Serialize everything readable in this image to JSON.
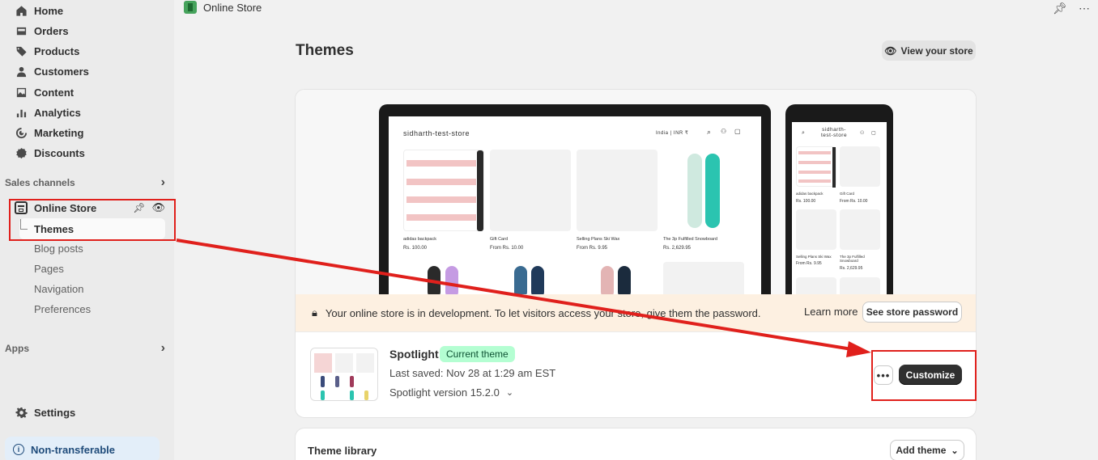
{
  "sidebar": {
    "nav": [
      {
        "label": "Home",
        "icon": "home-icon"
      },
      {
        "label": "Orders",
        "icon": "orders-icon"
      },
      {
        "label": "Products",
        "icon": "tag-icon"
      },
      {
        "label": "Customers",
        "icon": "person-icon"
      },
      {
        "label": "Content",
        "icon": "image-icon"
      },
      {
        "label": "Analytics",
        "icon": "bar-chart-icon"
      },
      {
        "label": "Marketing",
        "icon": "target-icon"
      },
      {
        "label": "Discounts",
        "icon": "discount-icon"
      }
    ],
    "sales_channels_label": "Sales channels",
    "online_store_label": "Online Store",
    "sub_items": [
      "Themes",
      "Blog posts",
      "Pages",
      "Navigation",
      "Preferences"
    ],
    "apps_label": "Apps",
    "settings_label": "Settings",
    "non_transferable_label": "Non-transferable"
  },
  "header": {
    "app_title": "Online Store"
  },
  "page": {
    "title": "Themes",
    "view_store_label": "View your store"
  },
  "preview": {
    "store_name": "sidharth-test-store",
    "phone_store_name_1": "sidharth-",
    "phone_store_name_2": "test-store",
    "currency": "India | INR ₹",
    "products": [
      {
        "name": "adidas backpack",
        "price": "Rs. 100.00"
      },
      {
        "name": "Gift Card",
        "price": "From Rs. 10.00"
      },
      {
        "name": "Selling Plans Ski Wax",
        "price": "From Rs. 9.95"
      },
      {
        "name": "The 3p Fulfilled Snowboard",
        "price": "Rs. 2,629.95"
      }
    ],
    "phone_products": [
      {
        "name": "adidas backpack",
        "price": "Rs. 100.00"
      },
      {
        "name": "Gift Card",
        "price": "From Rs. 10.00"
      },
      {
        "name": "Selling Plans Ski Wax",
        "price": "From Rs. 9.95"
      },
      {
        "name": "The 3p Fulfilled Snowboard",
        "price": "Rs. 2,629.95"
      }
    ]
  },
  "dev_banner": {
    "message": "Your online store is in development. To let visitors access your store, give them the password.",
    "learn_more": "Learn more",
    "see_password": "See store password"
  },
  "current_theme": {
    "name": "Spotlight",
    "badge": "Current theme",
    "last_saved": "Last saved: Nov 28 at 1:29 am EST",
    "version": "Spotlight version 15.2.0",
    "more_label": "•••",
    "customize_label": "Customize"
  },
  "library": {
    "title": "Theme library",
    "add_theme_label": "Add theme"
  },
  "colors": {
    "annotation_red": "#e0201c",
    "badge_green": "#b4fed2",
    "primary_button": "#303030",
    "dev_banner": "#fdf0e1"
  }
}
